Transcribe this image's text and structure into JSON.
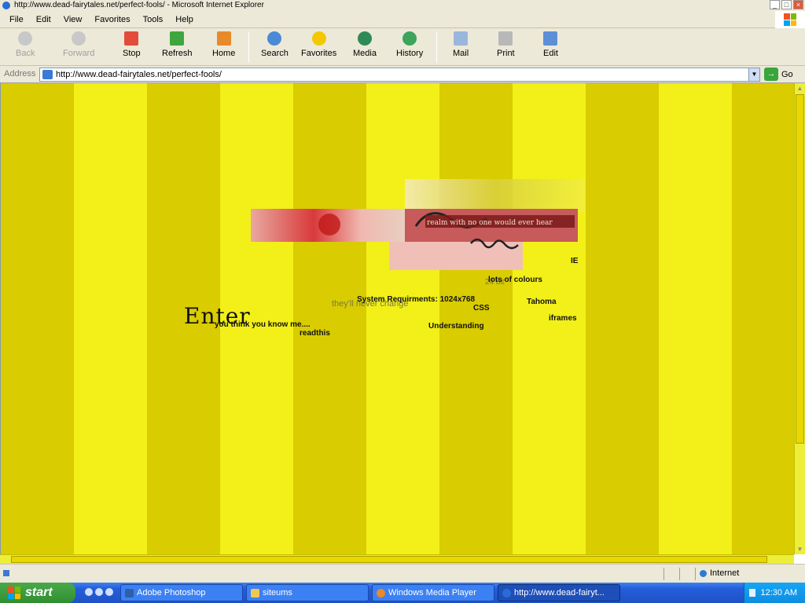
{
  "window": {
    "title": "http://www.dead-fairytales.net/perfect-fools/ - Microsoft Internet Explorer",
    "controls": [
      "_",
      "□",
      "×"
    ]
  },
  "menu": [
    "File",
    "Edit",
    "View",
    "Favorites",
    "Tools",
    "Help"
  ],
  "toolbar": {
    "back": "Back",
    "forward": "Forward",
    "stop": "Stop",
    "refresh": "Refresh",
    "home": "Home",
    "search": "Search",
    "favorites": "Favorites",
    "media": "Media",
    "history": "History",
    "mail": "Mail",
    "print": "Print",
    "edit": "Edit"
  },
  "address": {
    "label": "Address",
    "url": "http://www.dead-fairytales.net/perfect-fools/",
    "go": "Go"
  },
  "page": {
    "banner_text": "realm with no one would ever hear",
    "enter": "Enter",
    "tagline1": "you think you know me....",
    "tagline2": "they'll never change",
    "readthis": "readthis",
    "sysreq": "System Requirments: 1024x768",
    "ie": "IE",
    "colours": "lots of colours",
    "bit": "24 bit",
    "tahoma": "Tahoma",
    "css": "CSS",
    "iframes": "iframes",
    "understanding": "Understanding",
    "stripe_colors": [
      "#d9cc00",
      "#f2f018"
    ]
  },
  "status": {
    "zone": "Internet"
  },
  "taskbar": {
    "start": "start",
    "tasks": [
      {
        "label": "Adobe Photoshop",
        "active": false
      },
      {
        "label": "siteums",
        "active": false
      },
      {
        "label": "Windows Media Player",
        "active": false
      },
      {
        "label": "http://www.dead-fairyt...",
        "active": true
      }
    ],
    "clock": "12:30 AM"
  }
}
